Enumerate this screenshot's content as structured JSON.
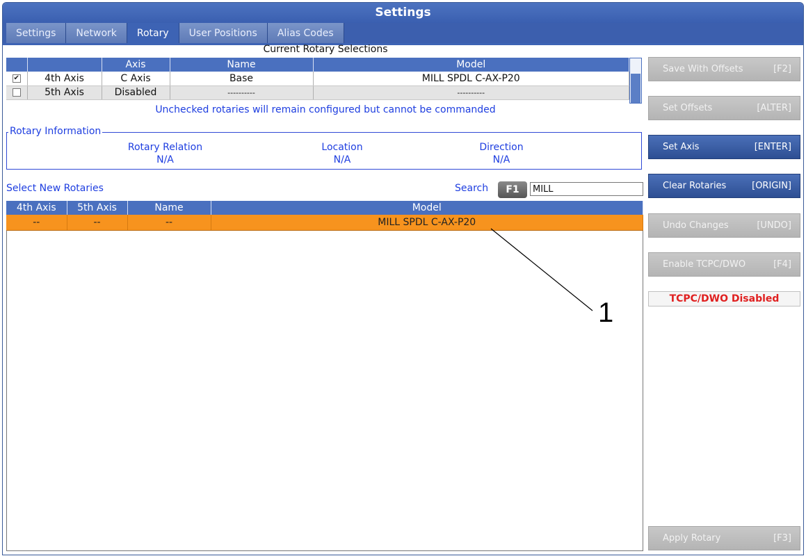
{
  "window": {
    "title": "Settings"
  },
  "tabs": [
    {
      "label": "Settings",
      "active": false
    },
    {
      "label": "Network",
      "active": false
    },
    {
      "label": "Rotary",
      "active": true
    },
    {
      "label": "User Positions",
      "active": false
    },
    {
      "label": "Alias Codes",
      "active": false
    }
  ],
  "current": {
    "caption": "Current Rotary Selections",
    "headers": [
      "",
      "Axis",
      "Name",
      "Model"
    ],
    "rows": [
      {
        "checked": true,
        "label": "4th Axis",
        "axis": "C Axis",
        "name": "Base",
        "model": "MILL SPDL C-AX-P20",
        "check_glyph": "✔"
      },
      {
        "checked": false,
        "label": "5th Axis",
        "axis": "Disabled",
        "name": "----------",
        "model": "----------",
        "check_glyph": ""
      }
    ],
    "note": "Unchecked rotaries will remain configured but cannot be commanded"
  },
  "info": {
    "legend": "Rotary Information",
    "relation_label": "Rotary Relation",
    "relation_value": "N/A",
    "location_label": "Location",
    "location_value": "N/A",
    "direction_label": "Direction",
    "direction_value": "N/A"
  },
  "select": {
    "label": "Select New Rotaries",
    "search_label": "Search",
    "search_key": "F1",
    "search_value": "MILL",
    "headers": [
      "4th Axis",
      "5th Axis",
      "Name",
      "Model"
    ],
    "rows": [
      {
        "a4": "--",
        "a5": "--",
        "name": "--",
        "model": "MILL SPDL C-AX-P20"
      }
    ]
  },
  "callout": "1",
  "buttons": {
    "save_offsets": {
      "label": "Save With Offsets",
      "key": "[F2]"
    },
    "set_offsets": {
      "label": "Set Offsets",
      "key": "[ALTER]"
    },
    "set_axis": {
      "label": "Set Axis",
      "key": "[ENTER]"
    },
    "clear_rotaries": {
      "label": "Clear Rotaries",
      "key": "[ORIGIN]"
    },
    "undo_changes": {
      "label": "Undo Changes",
      "key": "[UNDO]"
    },
    "enable_tcpc": {
      "label": "Enable TCPC/DWO",
      "key": "[F4]"
    },
    "apply_rotary": {
      "label": "Apply Rotary",
      "key": "[F3]"
    }
  },
  "status": {
    "tcpc": "TCPC/DWO Disabled"
  },
  "colors": {
    "title_blue": "#3d63b4",
    "selected_row": "#f7931e",
    "status_red": "#e02020"
  }
}
